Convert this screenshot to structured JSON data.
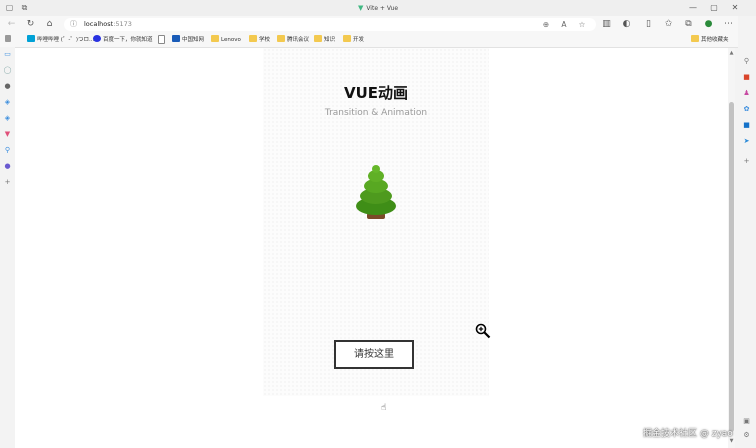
{
  "window": {
    "title": "Vite + Vue"
  },
  "address": {
    "host": "localhost",
    "port": ":5173"
  },
  "bookmarks": [
    {
      "label": "哔哩哔哩 (゜-゜)つロ...",
      "icon": "tv-icon",
      "color": "#00a1d6"
    },
    {
      "label": "百度一下，你就知道",
      "icon": "baidu-icon",
      "color": "#2932e1"
    },
    {
      "label": "",
      "icon": "page-icon",
      "color": "#888888"
    },
    {
      "label": "中国知网",
      "icon": "cnki-icon",
      "color": "#1a5cb8"
    },
    {
      "label": "Lenovo",
      "icon": "folder-icon",
      "color": "#f3c94f"
    },
    {
      "label": "学校",
      "icon": "folder-icon",
      "color": "#f3c94f"
    },
    {
      "label": "腾讯会议",
      "icon": "folder-icon",
      "color": "#f3c94f"
    },
    {
      "label": "知识",
      "icon": "folder-icon",
      "color": "#f3c94f"
    },
    {
      "label": "开发",
      "icon": "folder-icon",
      "color": "#f3c94f"
    }
  ],
  "other_favorites": "其他收藏夹",
  "page": {
    "title": "VUE动画",
    "subtitle": "Transition & Animation",
    "button_label": "请按这里"
  },
  "watermark": "掘金技术社区 @ zyao",
  "colors": {
    "tree_green": "#4e9a1e",
    "trunk": "#7b4a28",
    "vue_green": "#41b883"
  }
}
